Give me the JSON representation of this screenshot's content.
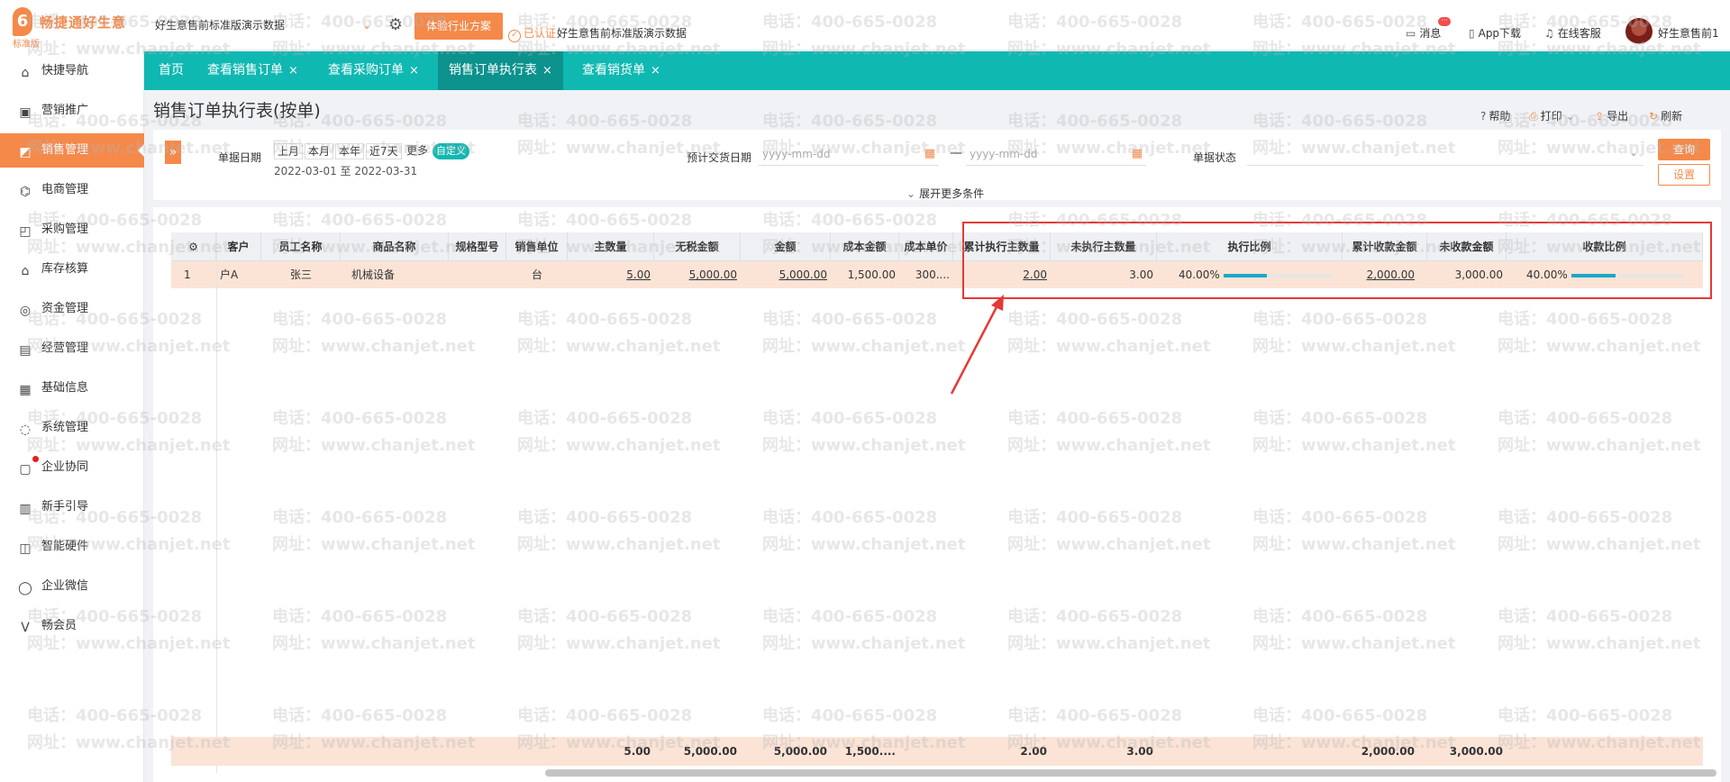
{
  "app": {
    "logo_mark": "6",
    "logo_name": "畅捷通好生意",
    "edition": "标准版",
    "company": "好生意售前标准版演示数据",
    "trial_button": "体验行业方案",
    "certified": "已认证",
    "certified_company": "好生意售前标准版演示数据",
    "messages": "消息",
    "messages_badge": "···",
    "app_download": "App下载",
    "online_service": "在线客服",
    "user": "好生意售前1"
  },
  "sidebar": {
    "items": [
      {
        "label": "快捷导航",
        "icon": "home-icon",
        "glyph": "⌂"
      },
      {
        "label": "营销推广",
        "icon": "gift-icon",
        "glyph": "▣"
      },
      {
        "label": "销售管理",
        "icon": "sales-icon",
        "glyph": "◩"
      },
      {
        "label": "电商管理",
        "icon": "shop-icon",
        "glyph": "⌬"
      },
      {
        "label": "采购管理",
        "icon": "bag-icon",
        "glyph": "◰"
      },
      {
        "label": "库存核算",
        "icon": "warehouse-icon",
        "glyph": "⌂"
      },
      {
        "label": "资金管理",
        "icon": "money-icon",
        "glyph": "◎"
      },
      {
        "label": "经营管理",
        "icon": "clipboard-icon",
        "glyph": "▤"
      },
      {
        "label": "基础信息",
        "icon": "info-icon",
        "glyph": "▦"
      },
      {
        "label": "系统管理",
        "icon": "system-icon",
        "glyph": "◌"
      },
      {
        "label": "企业协同",
        "icon": "collab-icon",
        "glyph": "▢"
      },
      {
        "label": "新手引导",
        "icon": "guide-icon",
        "glyph": "▥"
      },
      {
        "label": "智能硬件",
        "icon": "hardware-icon",
        "glyph": "◫"
      },
      {
        "label": "企业微信",
        "icon": "wechat-icon",
        "glyph": "◯"
      },
      {
        "label": "畅会员",
        "icon": "vip-icon",
        "glyph": "V"
      }
    ],
    "active_index": 2
  },
  "tabs": [
    {
      "label": "首页",
      "closable": false
    },
    {
      "label": "查看销售订单",
      "closable": true
    },
    {
      "label": "查看采购订单",
      "closable": true
    },
    {
      "label": "销售订单执行表",
      "closable": true
    },
    {
      "label": "查看销货单",
      "closable": true
    }
  ],
  "active_tab": 3,
  "page": {
    "title": "销售订单执行表(按单)",
    "actions": {
      "help": "帮助",
      "print": "打印",
      "export": "导出",
      "refresh": "刷新"
    }
  },
  "filter": {
    "date_label": "单据日期",
    "quick": [
      "上月",
      "本月",
      "本年",
      "近7天",
      "更多",
      "自定义"
    ],
    "date_range": "2022-03-01 至 2022-03-31",
    "delivery_label": "预计交货日期",
    "date_placeholder": "yyyy-mm-dd",
    "status_label": "单据状态",
    "query": "查询",
    "settings": "设置",
    "more_conditions": "展开更多条件"
  },
  "table": {
    "headers": [
      "客户",
      "员工名称",
      "商品名称",
      "规格型号",
      "销售单位",
      "主数量",
      "无税金额",
      "金额",
      "成本金额",
      "成本单价",
      "累计执行主数量",
      "未执行主数量",
      "执行比例",
      "累计收款金额",
      "未收款金额",
      "收款比例"
    ],
    "rows": [
      {
        "index": "1",
        "customer": "户A",
        "employee": "张三",
        "product": "机械设备",
        "spec": "",
        "unit": "台",
        "qty": "5.00",
        "amount_notax": "5,000.00",
        "amount": "5,000.00",
        "cost_amount": "1,500.00",
        "cost_price": "300....",
        "exec_qty": "2.00",
        "unexec_qty": "3.00",
        "exec_ratio": "40.00%",
        "exec_ratio_value": 0.4,
        "received": "2,000.00",
        "unreceived": "3,000.00",
        "receipt_ratio": "40.00%",
        "receipt_ratio_value": 0.4
      }
    ],
    "totals": {
      "qty": "5.00",
      "amount_notax": "5,000.00",
      "amount": "5,000.00",
      "cost_amount": "1,500....",
      "exec_qty": "2.00",
      "unexec_qty": "3.00",
      "received": "2,000.00",
      "unreceived": "3,000.00"
    }
  },
  "watermark": {
    "phone": "电话：400-665-0028",
    "site": "网址：www.chanjet.net"
  },
  "colors": {
    "brand": "#f5894a",
    "tabbar": "#10b8b2",
    "active_tab": "#0c928d",
    "row_highlight": "#fbe4d6",
    "annotation": "#e53935",
    "progress": "#1aa9c9"
  }
}
